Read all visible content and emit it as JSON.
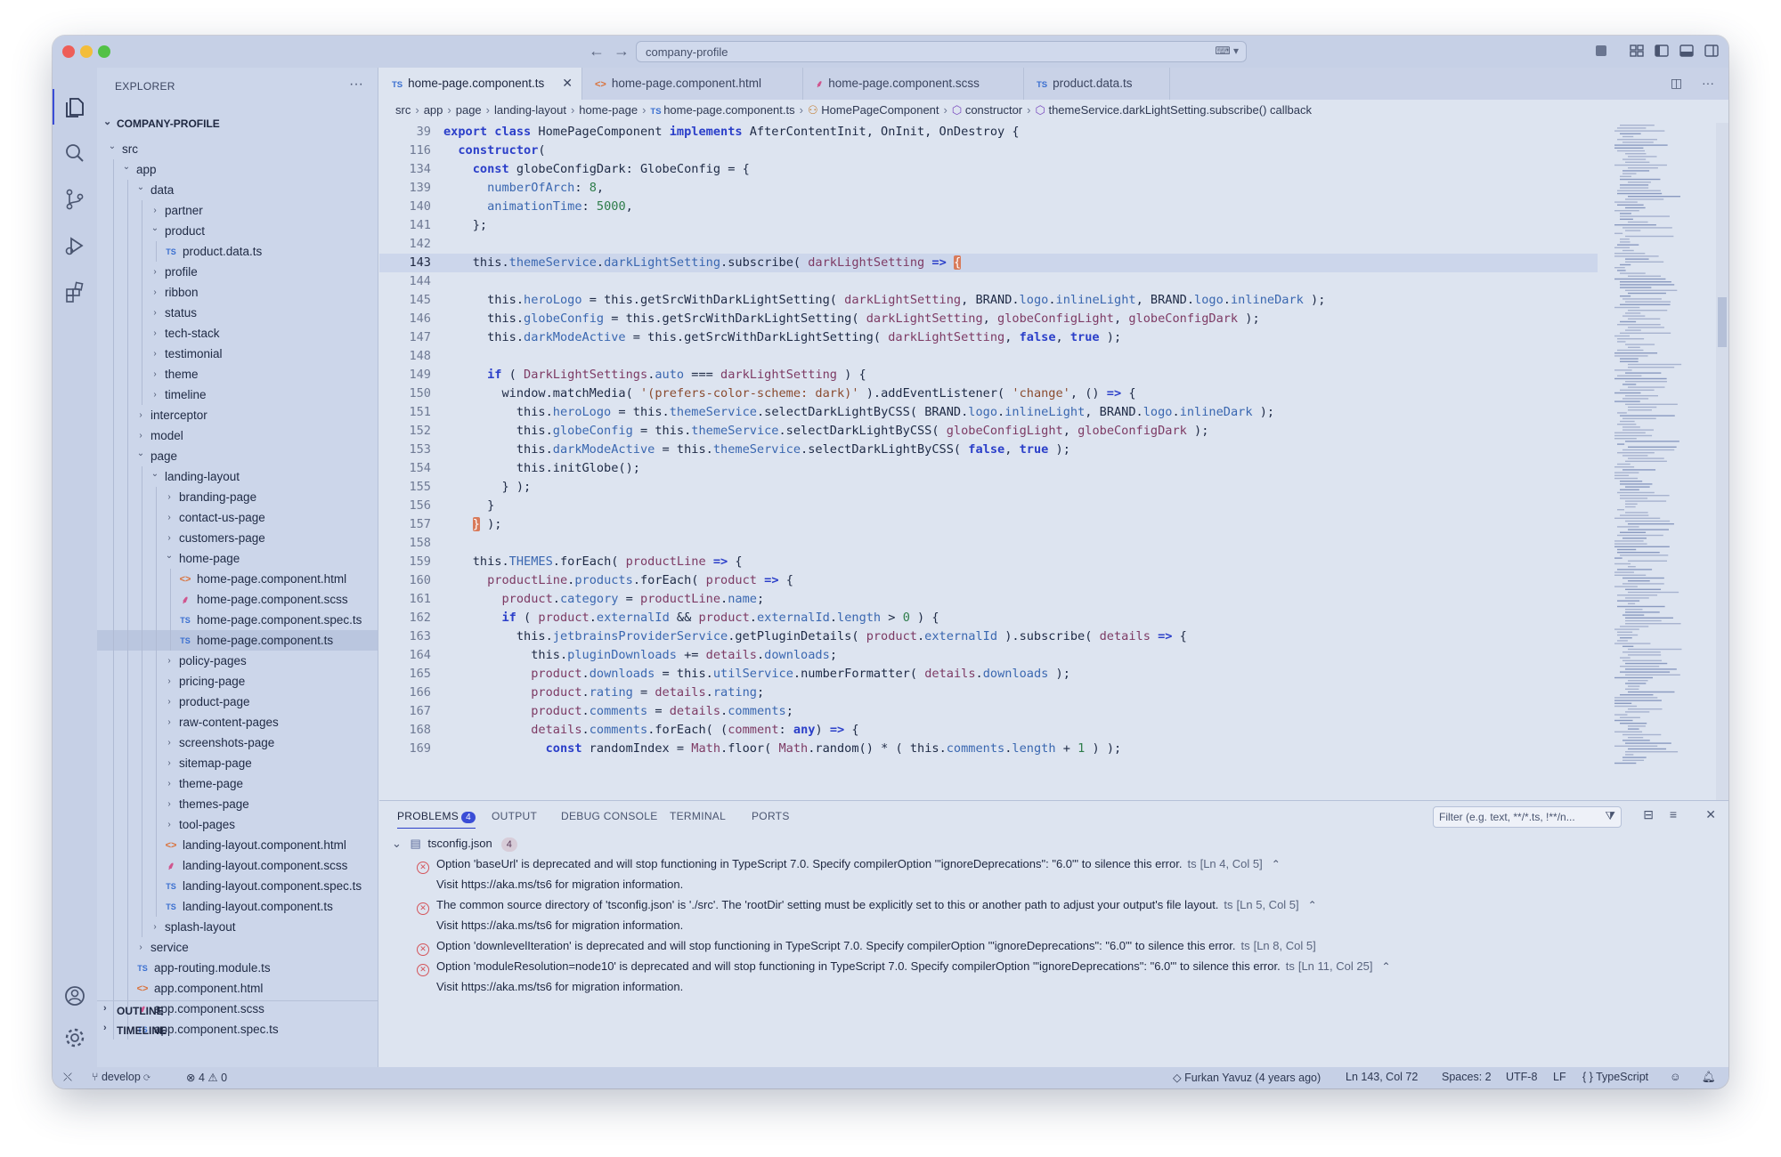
{
  "titlebar": {
    "search_text": "company-profile"
  },
  "sidebar": {
    "title": "EXPLORER",
    "root": "COMPANY-PROFILE",
    "tree": [
      {
        "label": "src",
        "type": "folder",
        "open": true,
        "level": 0
      },
      {
        "label": "app",
        "type": "folder",
        "open": true,
        "level": 1
      },
      {
        "label": "data",
        "type": "folder",
        "open": true,
        "level": 2
      },
      {
        "label": "partner",
        "type": "folder",
        "open": false,
        "level": 3
      },
      {
        "label": "product",
        "type": "folder",
        "open": true,
        "level": 3
      },
      {
        "label": "product.data.ts",
        "type": "ts",
        "level": 4
      },
      {
        "label": "profile",
        "type": "folder",
        "open": false,
        "level": 3
      },
      {
        "label": "ribbon",
        "type": "folder",
        "open": false,
        "level": 3
      },
      {
        "label": "status",
        "type": "folder",
        "open": false,
        "level": 3
      },
      {
        "label": "tech-stack",
        "type": "folder",
        "open": false,
        "level": 3
      },
      {
        "label": "testimonial",
        "type": "folder",
        "open": false,
        "level": 3
      },
      {
        "label": "theme",
        "type": "folder",
        "open": false,
        "level": 3
      },
      {
        "label": "timeline",
        "type": "folder",
        "open": false,
        "level": 3
      },
      {
        "label": "interceptor",
        "type": "folder",
        "open": false,
        "level": 2
      },
      {
        "label": "model",
        "type": "folder",
        "open": false,
        "level": 2
      },
      {
        "label": "page",
        "type": "folder",
        "open": true,
        "level": 2
      },
      {
        "label": "landing-layout",
        "type": "folder",
        "open": true,
        "level": 3
      },
      {
        "label": "branding-page",
        "type": "folder",
        "open": false,
        "level": 4
      },
      {
        "label": "contact-us-page",
        "type": "folder",
        "open": false,
        "level": 4
      },
      {
        "label": "customers-page",
        "type": "folder",
        "open": false,
        "level": 4
      },
      {
        "label": "home-page",
        "type": "folder",
        "open": true,
        "level": 4
      },
      {
        "label": "home-page.component.html",
        "type": "html",
        "level": 5
      },
      {
        "label": "home-page.component.scss",
        "type": "scss",
        "level": 5
      },
      {
        "label": "home-page.component.spec.ts",
        "type": "ts",
        "level": 5
      },
      {
        "label": "home-page.component.ts",
        "type": "ts",
        "level": 5,
        "selected": true
      },
      {
        "label": "policy-pages",
        "type": "folder",
        "open": false,
        "level": 4
      },
      {
        "label": "pricing-page",
        "type": "folder",
        "open": false,
        "level": 4
      },
      {
        "label": "product-page",
        "type": "folder",
        "open": false,
        "level": 4
      },
      {
        "label": "raw-content-pages",
        "type": "folder",
        "open": false,
        "level": 4
      },
      {
        "label": "screenshots-page",
        "type": "folder",
        "open": false,
        "level": 4
      },
      {
        "label": "sitemap-page",
        "type": "folder",
        "open": false,
        "level": 4
      },
      {
        "label": "theme-page",
        "type": "folder",
        "open": false,
        "level": 4
      },
      {
        "label": "themes-page",
        "type": "folder",
        "open": false,
        "level": 4
      },
      {
        "label": "tool-pages",
        "type": "folder",
        "open": false,
        "level": 4
      },
      {
        "label": "landing-layout.component.html",
        "type": "html",
        "level": 4
      },
      {
        "label": "landing-layout.component.scss",
        "type": "scss",
        "level": 4
      },
      {
        "label": "landing-layout.component.spec.ts",
        "type": "ts",
        "level": 4
      },
      {
        "label": "landing-layout.component.ts",
        "type": "ts",
        "level": 4
      },
      {
        "label": "splash-layout",
        "type": "folder",
        "open": false,
        "level": 3
      },
      {
        "label": "service",
        "type": "folder",
        "open": false,
        "level": 2
      },
      {
        "label": "app-routing.module.ts",
        "type": "ts",
        "level": 2
      },
      {
        "label": "app.component.html",
        "type": "html",
        "level": 2
      },
      {
        "label": "app.component.scss",
        "type": "scss",
        "level": 2
      },
      {
        "label": "app.component.spec.ts",
        "type": "ts",
        "level": 2
      }
    ],
    "outline_label": "OUTLINE",
    "timeline_label": "TIMELINE"
  },
  "tabs": [
    {
      "label": "home-page.component.ts",
      "icon": "TS",
      "active": true
    },
    {
      "label": "home-page.component.html",
      "icon": "<>",
      "active": false
    },
    {
      "label": "home-page.component.scss",
      "icon": "scss",
      "active": false
    },
    {
      "label": "product.data.ts",
      "icon": "TS",
      "active": false
    }
  ],
  "breadcrumb": [
    "src",
    "app",
    "page",
    "landing-layout",
    "home-page",
    "home-page.component.ts",
    "HomePageComponent",
    "constructor",
    "themeService.darkLightSetting.subscribe() callback"
  ],
  "code": [
    {
      "n": "39",
      "html": "<span class='kw'>export class</span> HomePageComponent <span class='kw'>implements</span> AfterContentInit, OnInit, OnDestroy {"
    },
    {
      "n": "116",
      "html": "  <span class='kw'>constructor</span>("
    },
    {
      "n": "134",
      "html": "    <span class='kw'>const</span> globeConfigDark: GlobeConfig = {"
    },
    {
      "n": "139",
      "html": "      <span class='prop'>numberOfArch</span>: <span class='num'>8</span>,"
    },
    {
      "n": "140",
      "html": "      <span class='prop'>animationTime</span>: <span class='num'>5000</span>,"
    },
    {
      "n": "141",
      "html": "    };"
    },
    {
      "n": "142",
      "html": ""
    },
    {
      "n": "143",
      "html": "    this.<span class='prop'>themeService</span>.<span class='prop'>darkLightSetting</span>.subscribe( <span class='var'>darkLightSetting</span> <span class='kw'>=&gt;</span> <span class='brk'>{</span>",
      "current": true
    },
    {
      "n": "144",
      "html": ""
    },
    {
      "n": "145",
      "html": "      this.<span class='prop'>heroLogo</span> = this.getSrcWithDarkLightSetting( <span class='var'>darkLightSetting</span>, BRAND.<span class='prop'>logo</span>.<span class='prop'>inlineLight</span>, BRAND.<span class='prop'>logo</span>.<span class='prop'>inlineDark</span> );"
    },
    {
      "n": "146",
      "html": "      this.<span class='prop'>globeConfig</span> = this.getSrcWithDarkLightSetting( <span class='var'>darkLightSetting</span>, <span class='var'>globeConfigLight</span>, <span class='var'>globeConfigDark</span> );"
    },
    {
      "n": "147",
      "html": "      this.<span class='prop'>darkModeActive</span> = this.getSrcWithDarkLightSetting( <span class='var'>darkLightSetting</span>, <span class='kw'>false</span>, <span class='kw'>true</span> );"
    },
    {
      "n": "148",
      "html": ""
    },
    {
      "n": "149",
      "html": "      <span class='kw'>if</span> ( <span class='var'>DarkLightSettings</span>.<span class='prop'>auto</span> === <span class='var'>darkLightSetting</span> ) {"
    },
    {
      "n": "150",
      "html": "        window.matchMedia( <span class='str'>'(prefers-color-scheme: dark)'</span> ).addEventListener( <span class='str'>'change'</span>, () <span class='kw'>=&gt;</span> {"
    },
    {
      "n": "151",
      "html": "          this.<span class='prop'>heroLogo</span> = this.<span class='prop'>themeService</span>.selectDarkLightByCSS( BRAND.<span class='prop'>logo</span>.<span class='prop'>inlineLight</span>, BRAND.<span class='prop'>logo</span>.<span class='prop'>inlineDark</span> );"
    },
    {
      "n": "152",
      "html": "          this.<span class='prop'>globeConfig</span> = this.<span class='prop'>themeService</span>.selectDarkLightByCSS( <span class='var'>globeConfigLight</span>, <span class='var'>globeConfigDark</span> );"
    },
    {
      "n": "153",
      "html": "          this.<span class='prop'>darkModeActive</span> = this.<span class='prop'>themeService</span>.selectDarkLightByCSS( <span class='kw'>false</span>, <span class='kw'>true</span> );"
    },
    {
      "n": "154",
      "html": "          this.initGlobe();"
    },
    {
      "n": "155",
      "html": "        } );"
    },
    {
      "n": "156",
      "html": "      }"
    },
    {
      "n": "157",
      "html": "    <span class='brk'>}</span> );"
    },
    {
      "n": "158",
      "html": ""
    },
    {
      "n": "159",
      "html": "    this.<span class='prop'>THEMES</span>.forEach( <span class='var'>productLine</span> <span class='kw'>=&gt;</span> {"
    },
    {
      "n": "160",
      "html": "      <span class='var'>productLine</span>.<span class='prop'>products</span>.forEach( <span class='var'>product</span> <span class='kw'>=&gt;</span> {"
    },
    {
      "n": "161",
      "html": "        <span class='var'>product</span>.<span class='prop'>category</span> = <span class='var'>productLine</span>.<span class='prop'>name</span>;"
    },
    {
      "n": "162",
      "html": "        <span class='kw'>if</span> ( <span class='var'>product</span>.<span class='prop'>externalId</span> &amp;&amp; <span class='var'>product</span>.<span class='prop'>externalId</span>.<span class='prop'>length</span> &gt; <span class='num'>0</span> ) {"
    },
    {
      "n": "163",
      "html": "          this.<span class='prop'>jetbrainsProviderService</span>.getPluginDetails( <span class='var'>product</span>.<span class='prop'>externalId</span> ).subscribe( <span class='var'>details</span> <span class='kw'>=&gt;</span> {"
    },
    {
      "n": "164",
      "html": "            this.<span class='prop'>pluginDownloads</span> += <span class='var'>details</span>.<span class='prop'>downloads</span>;"
    },
    {
      "n": "165",
      "html": "            <span class='var'>product</span>.<span class='prop'>downloads</span> = this.<span class='prop'>utilService</span>.numberFormatter( <span class='var'>details</span>.<span class='prop'>downloads</span> );"
    },
    {
      "n": "166",
      "html": "            <span class='var'>product</span>.<span class='prop'>rating</span> = <span class='var'>details</span>.<span class='prop'>rating</span>;"
    },
    {
      "n": "167",
      "html": "            <span class='var'>product</span>.<span class='prop'>comments</span> = <span class='var'>details</span>.<span class='prop'>comments</span>;"
    },
    {
      "n": "168",
      "html": "            <span class='var'>details</span>.<span class='prop'>comments</span>.forEach( (<span class='var'>comment</span>: <span class='kw'>any</span>) <span class='kw'>=&gt;</span> {"
    },
    {
      "n": "169",
      "html": "              <span class='kw'>const</span> randomIndex = <span class='var'>Math</span>.floor( <span class='var'>Math</span>.random() * ( this.<span class='prop'>comments</span>.<span class='prop'>length</span> + <span class='num'>1</span> ) );"
    }
  ],
  "panel": {
    "tabs": [
      "PROBLEMS",
      "OUTPUT",
      "DEBUG CONSOLE",
      "TERMINAL",
      "PORTS"
    ],
    "problems_count": "4",
    "filter_placeholder": "Filter (e.g. text, **/*.ts, !**/n...",
    "file": "tsconfig.json",
    "file_count": "4",
    "items": [
      {
        "message": "Option 'baseUrl' is deprecated and will stop functioning in TypeScript 7.0. Specify compilerOption '\"ignoreDeprecations\": \"6.0\"' to silence this error.",
        "source": "ts",
        "location": "[Ln 4, Col 5]",
        "detail": "Visit https://aka.ms/ts6 for migration information.",
        "expanded": true
      },
      {
        "message": "The common source directory of 'tsconfig.json' is './src'. The 'rootDir' setting must be explicitly set to this or another path to adjust your output's file layout.",
        "source": "ts",
        "location": "[Ln 5, Col 5]",
        "detail": "Visit https://aka.ms/ts6 for migration information.",
        "expanded": true
      },
      {
        "message": "Option 'downlevelIteration' is deprecated and will stop functioning in TypeScript 7.0. Specify compilerOption '\"ignoreDeprecations\": \"6.0\"' to silence this error.",
        "source": "ts",
        "location": "[Ln 8, Col 5]",
        "detail": "",
        "expanded": false
      },
      {
        "message": "Option 'moduleResolution=node10' is deprecated and will stop functioning in TypeScript 7.0. Specify compilerOption '\"ignoreDeprecations\": \"6.0\"' to silence this error.",
        "source": "ts",
        "location": "[Ln 11, Col 25]",
        "detail": "Visit https://aka.ms/ts6 for migration information.",
        "expanded": true
      }
    ]
  },
  "statusbar": {
    "branch": "develop",
    "errors": "4",
    "warnings": "0",
    "blame": "Furkan Yavuz (4 years ago)",
    "position": "Ln 143, Col 72",
    "spaces": "Spaces: 2",
    "encoding": "UTF-8",
    "eol": "LF",
    "language": "TypeScript"
  },
  "colors": {
    "accent": "#3a4dd6",
    "error": "#d4545a",
    "background": "#dde4f0"
  }
}
